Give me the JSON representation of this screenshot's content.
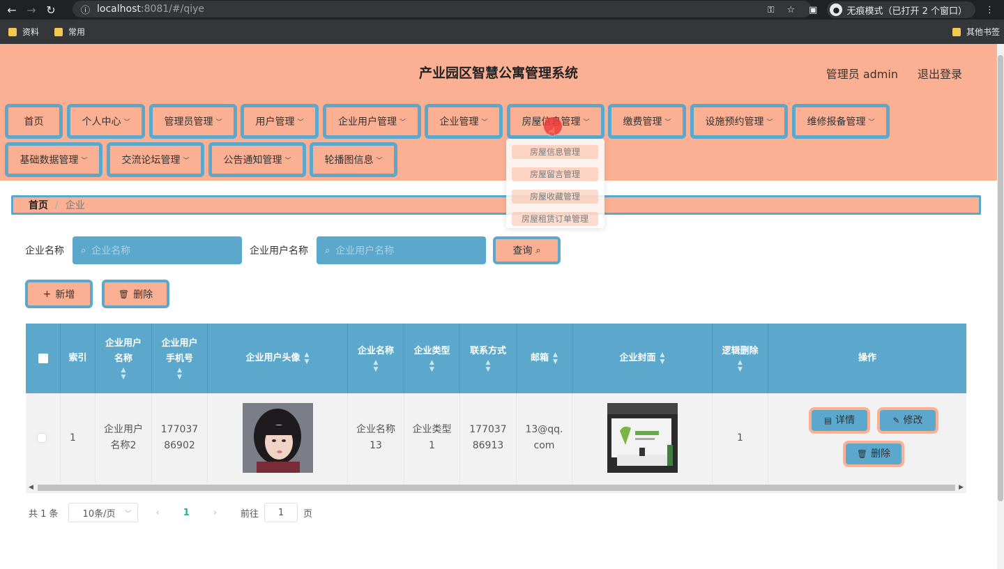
{
  "browser": {
    "url_host": "localhost",
    "url_rest": ":8081/#/qiye",
    "incognito_label": "无痕模式（已打开 2 个窗口）",
    "bookmarks": [
      "资料",
      "常用"
    ],
    "other_bookmarks": "其他书签"
  },
  "header": {
    "title": "产业园区智慧公寓管理系统",
    "user": "管理员 admin",
    "logout": "退出登录"
  },
  "nav": {
    "row1": [
      "首页",
      "个人中心",
      "管理员管理",
      "用户管理",
      "企业用户管理",
      "企业管理",
      "房屋信息管理",
      "缴费管理",
      "设施预约管理",
      "维修报备管理"
    ],
    "row2": [
      "基础数据管理",
      "交流论坛管理",
      "公告通知管理",
      "轮播图信息"
    ]
  },
  "dropdown": {
    "items": [
      "房屋信息管理",
      "房屋留言管理",
      "房屋收藏管理",
      "房屋租赁订单管理"
    ]
  },
  "breadcrumb": {
    "home": "首页",
    "sep": "/",
    "current": "企业"
  },
  "search": {
    "company_label": "企业名称",
    "company_placeholder": "企业名称",
    "user_label": "企业用户名称",
    "user_placeholder": "企业用户名称",
    "query_button": "查询"
  },
  "actions": {
    "add": "新增",
    "delete": "删除"
  },
  "table": {
    "headers": {
      "index": "索引",
      "user_name": "企业用户名称",
      "phone": "企业用户手机号",
      "avatar": "企业用户头像",
      "company_name": "企业名称",
      "company_type": "企业类型",
      "contact": "联系方式",
      "email": "邮箱",
      "cover": "企业封面",
      "logic_delete": "逻辑删除",
      "ops": "操作"
    },
    "rows": [
      {
        "index": "1",
        "user_name": "企业用户名称2",
        "phone": "17703786902",
        "company_name": "企业名称13",
        "company_type": "企业类型1",
        "contact": "17703786913",
        "email": "13@qq.com",
        "logic_delete": "1",
        "detail": "详情",
        "edit": "修改",
        "delete": "删除"
      }
    ]
  },
  "pager": {
    "total": "共 1 条",
    "page_size": "10条/页",
    "current": "1",
    "goto_prefix": "前往",
    "goto_value": "1",
    "goto_suffix": "页"
  },
  "colors": {
    "salmon": "#fbb094",
    "blue": "#5ba8cc"
  }
}
